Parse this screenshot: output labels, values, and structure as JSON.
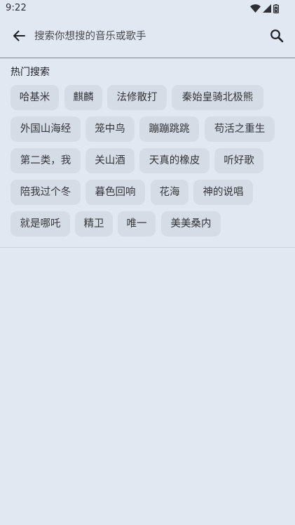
{
  "status_bar": {
    "time": "9:22",
    "icons": [
      "wifi-icon",
      "cellular-signal-icon",
      "battery-icon"
    ]
  },
  "search": {
    "placeholder": "搜索你想搜的音乐或歌手",
    "value": "",
    "back_icon": "arrow-left-icon",
    "search_icon": "search-icon"
  },
  "hot_search": {
    "title": "热门搜索",
    "chips": [
      "哈基米",
      "麒麟",
      "法修散打",
      "秦始皇骑北极熊",
      "外国山海经",
      "笼中鸟",
      "蹦蹦跳跳",
      "苟活之重生",
      "第二类，我",
      "关山酒",
      "天真的橡皮",
      "听好歌",
      "陪我过个冬",
      "暮色回响",
      "花海",
      "神的说唱",
      "就是哪吒",
      "精卫",
      "唯一",
      "美美桑内"
    ]
  },
  "colors": {
    "background": "#e2e8f1",
    "chip": "#d6dce5",
    "text": "#1c1f24"
  }
}
